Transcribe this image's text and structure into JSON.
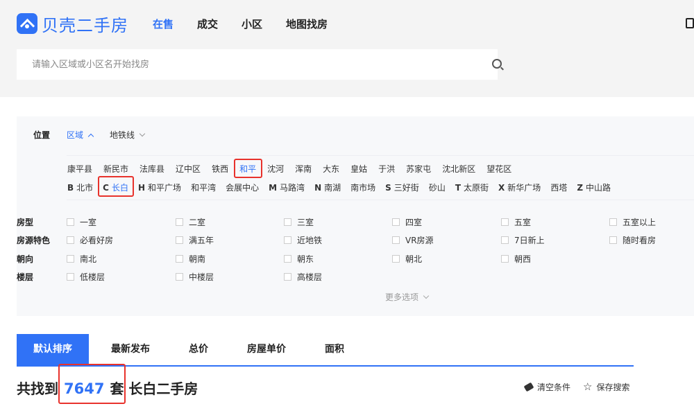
{
  "brand": {
    "name": "贝壳二手房",
    "accent": "#3072f6",
    "highlight": "#e8322c"
  },
  "nav": {
    "items": [
      "在售",
      "成交",
      "小区",
      "地图找房"
    ],
    "active": 0
  },
  "search": {
    "placeholder": "请输入区域或小区名开始找房",
    "value": ""
  },
  "location": {
    "label": "位置",
    "tabs": [
      "区域",
      "地铁线"
    ],
    "active_tab": 0,
    "districts": [
      "康平县",
      "新民市",
      "法库县",
      "辽中区",
      "铁西",
      "和平",
      "沈河",
      "浑南",
      "大东",
      "皇姑",
      "于洪",
      "苏家屯",
      "沈北新区",
      "望花区"
    ],
    "selected_district": "和平",
    "subareas": [
      {
        "letter": "B",
        "name": "北市"
      },
      {
        "letter": "C",
        "name": "长白"
      },
      {
        "letter": "H",
        "name": "和平广场"
      },
      {
        "letter": "",
        "name": "和平湾"
      },
      {
        "letter": "",
        "name": "会展中心"
      },
      {
        "letter": "M",
        "name": "马路湾"
      },
      {
        "letter": "N",
        "name": "南湖"
      },
      {
        "letter": "",
        "name": "南市场"
      },
      {
        "letter": "S",
        "name": "三好街"
      },
      {
        "letter": "",
        "name": "砂山"
      },
      {
        "letter": "T",
        "name": "太原街"
      },
      {
        "letter": "X",
        "name": "新华广场"
      },
      {
        "letter": "",
        "name": "西塔"
      },
      {
        "letter": "Z",
        "name": "中山路"
      }
    ],
    "selected_subarea": "长白"
  },
  "filters": [
    {
      "label": "房型",
      "options": [
        "一室",
        "二室",
        "三室",
        "四室",
        "五室",
        "五室以上"
      ]
    },
    {
      "label": "房源特色",
      "options": [
        "必看好房",
        "满五年",
        "近地铁",
        "VR房源",
        "7日新上",
        "随时看房"
      ]
    },
    {
      "label": "朝向",
      "options": [
        "南北",
        "朝南",
        "朝东",
        "朝北",
        "朝西"
      ]
    },
    {
      "label": "楼层",
      "options": [
        "低楼层",
        "中楼层",
        "高楼层"
      ]
    }
  ],
  "more_options": "更多选项",
  "sort_tabs": [
    "默认排序",
    "最新发布",
    "总价",
    "房屋单价",
    "面积"
  ],
  "sort_active": 0,
  "result": {
    "prefix": "共找到",
    "count": "7647",
    "suffix": "套 长白二手房"
  },
  "actions": {
    "clear": "清空条件",
    "save": "保存搜索"
  }
}
